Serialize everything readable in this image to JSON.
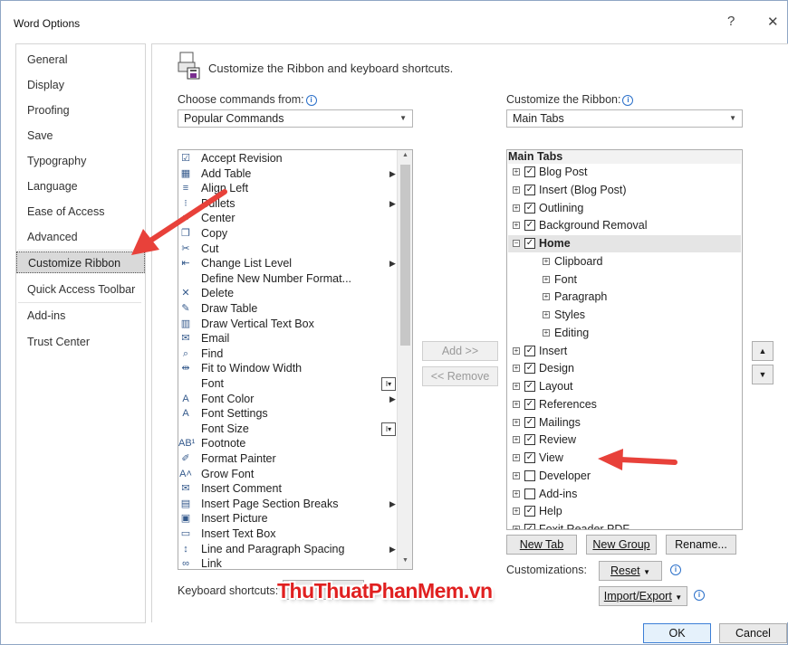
{
  "window": {
    "title": "Word Options",
    "help": "?",
    "close": "✕"
  },
  "nav": [
    {
      "label": "General",
      "selected": false
    },
    {
      "label": "Display",
      "selected": false
    },
    {
      "label": "Proofing",
      "selected": false
    },
    {
      "label": "Save",
      "selected": false
    },
    {
      "label": "Typography",
      "selected": false
    },
    {
      "label": "Language",
      "selected": false
    },
    {
      "label": "Ease of Access",
      "selected": false
    },
    {
      "label": "Advanced",
      "selected": false
    },
    {
      "label": "Customize Ribbon",
      "selected": true
    },
    {
      "label": "Quick Access Toolbar",
      "selected": false
    },
    {
      "label": "Add-ins",
      "selected": false
    },
    {
      "label": "Trust Center",
      "selected": false
    }
  ],
  "header": {
    "title": "Customize the Ribbon and keyboard shortcuts."
  },
  "commands": {
    "label": "Choose commands from:",
    "selected": "Popular Commands",
    "items": [
      {
        "label": "Accept Revision",
        "icon": "☑",
        "submenu": false
      },
      {
        "label": "Add Table",
        "icon": "▦",
        "submenu": true
      },
      {
        "label": "Align Left",
        "icon": "≡",
        "submenu": false
      },
      {
        "label": "Bullets",
        "icon": "⁝",
        "submenu": true
      },
      {
        "label": "Center",
        "icon": "≡",
        "submenu": false
      },
      {
        "label": "Copy",
        "icon": "❐",
        "submenu": false
      },
      {
        "label": "Cut",
        "icon": "✂",
        "submenu": false
      },
      {
        "label": "Change List Level",
        "icon": "⇤",
        "submenu": true
      },
      {
        "label": "Define New Number Format...",
        "icon": "",
        "submenu": false
      },
      {
        "label": "Delete",
        "icon": "✕",
        "submenu": false
      },
      {
        "label": "Draw Table",
        "icon": "✎",
        "submenu": false
      },
      {
        "label": "Draw Vertical Text Box",
        "icon": "▥",
        "submenu": false
      },
      {
        "label": "Email",
        "icon": "✉",
        "submenu": false
      },
      {
        "label": "Find",
        "icon": "⌕",
        "submenu": false
      },
      {
        "label": "Fit to Window Width",
        "icon": "⇹",
        "submenu": false
      },
      {
        "label": "Font",
        "icon": "",
        "submenu": false
      },
      {
        "label": "Font Color",
        "icon": "A",
        "submenu": true
      },
      {
        "label": "Font Settings",
        "icon": "A",
        "submenu": false
      },
      {
        "label": "Font Size",
        "icon": "",
        "submenu": false
      },
      {
        "label": "Footnote",
        "icon": "AB¹",
        "submenu": false
      },
      {
        "label": "Format Painter",
        "icon": "✐",
        "submenu": false
      },
      {
        "label": "Grow Font",
        "icon": "A˄",
        "submenu": false
      },
      {
        "label": "Insert Comment",
        "icon": "✉",
        "submenu": false
      },
      {
        "label": "Insert Page  Section Breaks",
        "icon": "▤",
        "submenu": true
      },
      {
        "label": "Insert Picture",
        "icon": "▣",
        "submenu": false
      },
      {
        "label": "Insert Text Box",
        "icon": "▭",
        "submenu": false
      },
      {
        "label": "Line and Paragraph Spacing",
        "icon": "↕",
        "submenu": true
      },
      {
        "label": "Link",
        "icon": "∞",
        "submenu": false
      }
    ]
  },
  "ribbon": {
    "label": "Customize the Ribbon:",
    "selected": "Main Tabs",
    "header": "Main Tabs",
    "items": [
      {
        "label": "Blog Post",
        "level": 0,
        "checked": true,
        "expanded": false
      },
      {
        "label": "Insert (Blog Post)",
        "level": 0,
        "checked": true,
        "expanded": false
      },
      {
        "label": "Outlining",
        "level": 0,
        "checked": true,
        "expanded": false
      },
      {
        "label": "Background Removal",
        "level": 0,
        "checked": true,
        "expanded": false
      },
      {
        "label": "Home",
        "level": 0,
        "checked": true,
        "expanded": true
      },
      {
        "label": "Clipboard",
        "level": 1
      },
      {
        "label": "Font",
        "level": 1
      },
      {
        "label": "Paragraph",
        "level": 1
      },
      {
        "label": "Styles",
        "level": 1
      },
      {
        "label": "Editing",
        "level": 1
      },
      {
        "label": "Insert",
        "level": 0,
        "checked": true,
        "expanded": false
      },
      {
        "label": "Design",
        "level": 0,
        "checked": true,
        "expanded": false
      },
      {
        "label": "Layout",
        "level": 0,
        "checked": true,
        "expanded": false
      },
      {
        "label": "References",
        "level": 0,
        "checked": true,
        "expanded": false
      },
      {
        "label": "Mailings",
        "level": 0,
        "checked": true,
        "expanded": false
      },
      {
        "label": "Review",
        "level": 0,
        "checked": true,
        "expanded": false
      },
      {
        "label": "View",
        "level": 0,
        "checked": true,
        "expanded": false
      },
      {
        "label": "Developer",
        "level": 0,
        "checked": false,
        "expanded": false
      },
      {
        "label": "Add-ins",
        "level": 0,
        "checked": false,
        "expanded": false
      },
      {
        "label": "Help",
        "level": 0,
        "checked": true,
        "expanded": false
      },
      {
        "label": "Foxit Reader PDF",
        "level": 0,
        "checked": true,
        "expanded": false
      }
    ]
  },
  "buttons": {
    "add": "Add >>",
    "remove": "<< Remove",
    "new_tab": "New Tab",
    "new_group": "New Group",
    "rename": "Rename...",
    "reset": "Reset",
    "import_export": "Import/Export",
    "ok": "OK",
    "cancel": "Cancel"
  },
  "customizations_label": "Customizations:",
  "shortcuts_label": "Keyboard shortcuts:",
  "watermark": "ThuThuatPhanMem.vn",
  "colors": {
    "arrow": "#e8413a",
    "accent": "#3c7fd6"
  }
}
